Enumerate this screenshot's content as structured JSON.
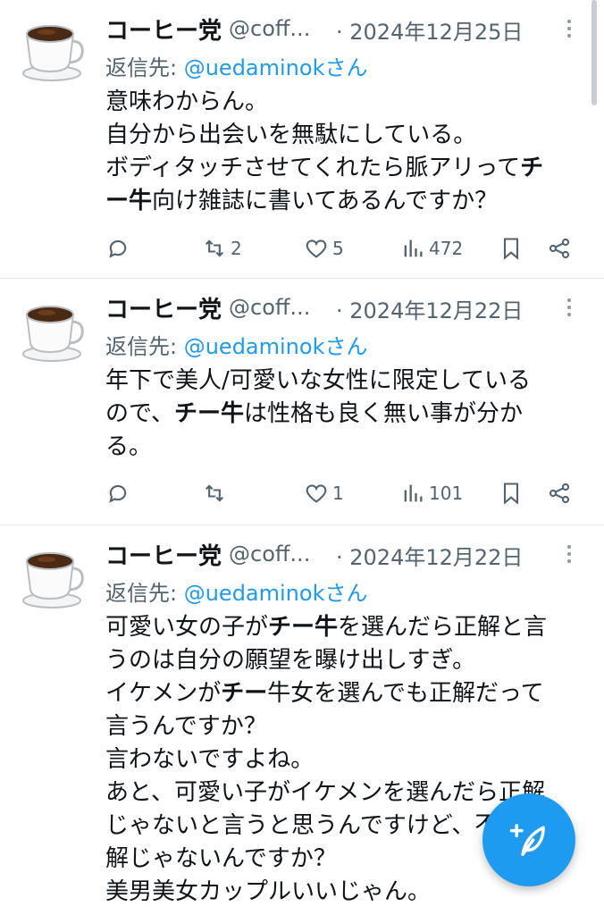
{
  "tweets": [
    {
      "name": "コーヒー党",
      "handle": "@coff...",
      "date": "· 2024年12月25日",
      "reply_prefix": "返信先: ",
      "reply_mention": "@uedaminokさん",
      "lines": [
        [
          {
            "t": "意味わからん。"
          }
        ],
        [
          {
            "t": "自分から出会いを無駄にしている。"
          }
        ],
        [
          {
            "t": "ボディタッチさせてくれたら脈アリって"
          },
          {
            "t": "チ",
            "b": true
          }
        ],
        [
          {
            "t": "ー牛",
            "b": true
          },
          {
            "t": "向け雑誌に書いてあるんですか？"
          }
        ]
      ],
      "retweets": "2",
      "likes": "5",
      "views": "472"
    },
    {
      "name": "コーヒー党",
      "handle": "@coff...",
      "date": "· 2024年12月22日",
      "reply_prefix": "返信先: ",
      "reply_mention": "@uedaminokさん",
      "lines": [
        [
          {
            "t": "年下で美人/可愛いな女性に限定している"
          }
        ],
        [
          {
            "t": "ので、"
          },
          {
            "t": "チー牛",
            "b": true
          },
          {
            "t": "は性格も良く無い事が分か"
          }
        ],
        [
          {
            "t": "る。"
          }
        ]
      ],
      "retweets": "",
      "likes": "1",
      "views": "101"
    },
    {
      "name": "コーヒー党",
      "handle": "@coff...",
      "date": "· 2024年12月22日",
      "reply_prefix": "返信先: ",
      "reply_mention": "@uedaminokさん",
      "lines": [
        [
          {
            "t": "可愛い女の子が"
          },
          {
            "t": "チー牛",
            "b": true
          },
          {
            "t": "を選んだら正解と言"
          }
        ],
        [
          {
            "t": "うのは自分の願望を曝け出しすぎ。"
          }
        ],
        [
          {
            "t": "イケメンが"
          },
          {
            "t": "チー",
            "b": true
          },
          {
            "t": "牛女を選んでも正解だって"
          }
        ],
        [
          {
            "t": "言うんですか？"
          }
        ],
        [
          {
            "t": "言わないですよね。"
          }
        ],
        [
          {
            "t": "あと、可愛い子がイケメンを選んだら正解"
          }
        ],
        [
          {
            "t": "じゃないと言うと思うんですけど、不正"
          }
        ],
        [
          {
            "t": "解じゃないんですか？"
          }
        ],
        [
          {
            "t": "美男美女カップルいいじゃん。"
          }
        ]
      ]
    }
  ],
  "icons": [
    "coffee-cup-icon",
    "more-icon",
    "reply-icon",
    "retweet-icon",
    "like-icon",
    "views-icon",
    "bookmark-icon",
    "share-icon",
    "compose-icon"
  ],
  "colors": {
    "accent": "#1d9bf0",
    "muted": "#536471",
    "text": "#0f1419",
    "divider": "#e6e9eb"
  }
}
